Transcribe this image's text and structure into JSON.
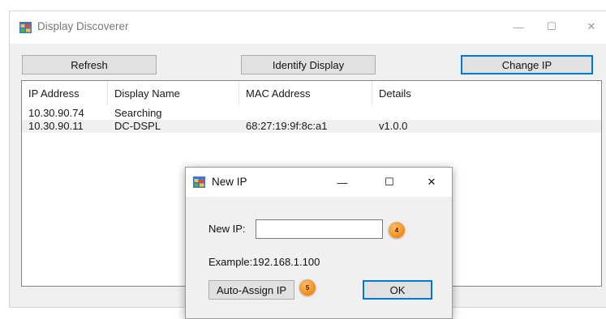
{
  "main_window": {
    "title": "Display Discoverer",
    "icon": "app-window-icon",
    "controls": {
      "minimize": "—",
      "maximize": "☐",
      "close": "✕"
    },
    "toolbar": {
      "refresh_label": "Refresh",
      "identify_label": "Identify Display",
      "change_ip_label": "Change IP"
    },
    "table": {
      "columns": [
        "IP Address",
        "Display Name",
        "MAC Address",
        "Details"
      ],
      "rows": [
        [
          "10.30.90.74",
          "Searching",
          "",
          ""
        ],
        [
          "10.30.90.11",
          "DC-DSPL",
          "68:27:19:9f:8c:a1",
          "v1.0.0"
        ]
      ]
    }
  },
  "dialog": {
    "title": "New IP",
    "icon": "app-window-icon",
    "controls": {
      "minimize": "—",
      "maximize": "☐",
      "close": "✕"
    },
    "ip_label": "New IP:",
    "ip_value": "",
    "example": "Example:192.168.1.100",
    "auto_assign_label": "Auto-Assign IP",
    "ok_label": "OK",
    "badges": {
      "ip_field": "4",
      "auto_assign": "5"
    }
  },
  "colors": {
    "focus_border": "#0078d7",
    "badge": "#f3962a"
  }
}
